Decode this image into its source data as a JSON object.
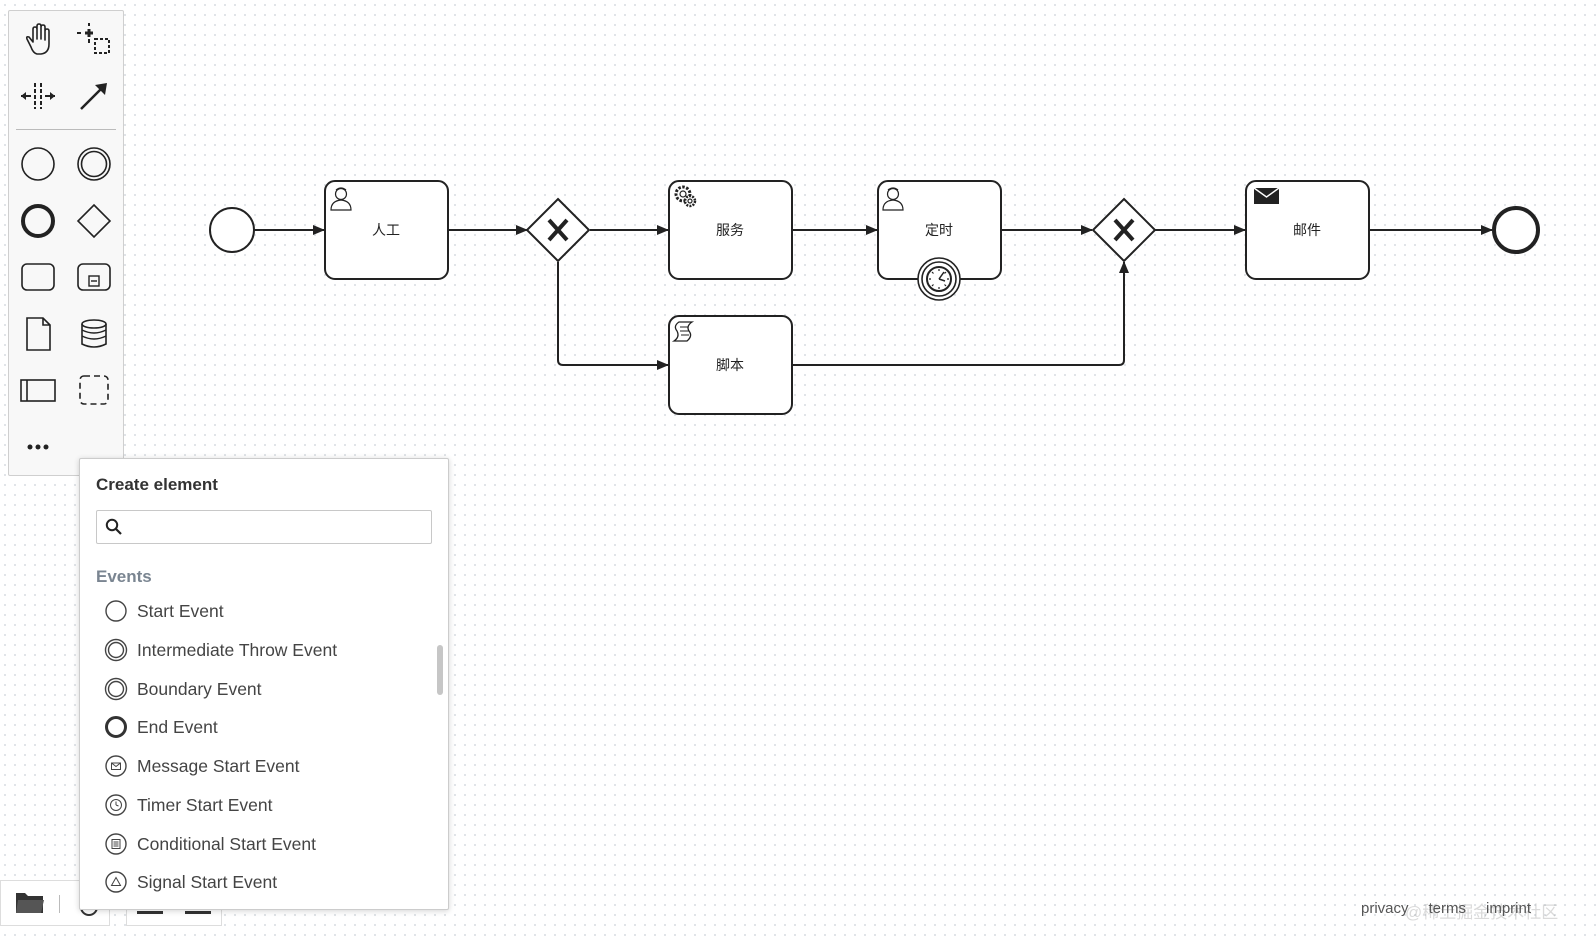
{
  "diagram": {
    "tasks": [
      {
        "label": "人工",
        "type": "user-task"
      },
      {
        "label": "服务",
        "type": "service-task"
      },
      {
        "label": "定时",
        "type": "user-task"
      },
      {
        "label": "邮件",
        "type": "send-task"
      },
      {
        "label": "脚本",
        "type": "script-task"
      }
    ]
  },
  "palette": {
    "tools": [
      "hand-tool",
      "lasso-tool",
      "space-tool",
      "global-connect-tool"
    ],
    "shapes": [
      "start-event",
      "intermediate-event",
      "end-event",
      "gateway",
      "task",
      "subprocess",
      "data-object",
      "data-store",
      "pool",
      "group",
      "more"
    ]
  },
  "popup": {
    "title": "Create element",
    "search_placeholder": "",
    "group": "Events",
    "entries": [
      {
        "label": "Start Event",
        "icon": "start-event-icon"
      },
      {
        "label": "Intermediate Throw Event",
        "icon": "intermediate-event-icon"
      },
      {
        "label": "Boundary Event",
        "icon": "boundary-event-icon"
      },
      {
        "label": "End Event",
        "icon": "end-event-icon"
      },
      {
        "label": "Message Start Event",
        "icon": "message-start-event-icon"
      },
      {
        "label": "Timer Start Event",
        "icon": "timer-start-event-icon"
      },
      {
        "label": "Conditional Start Event",
        "icon": "conditional-start-event-icon"
      },
      {
        "label": "Signal Start Event",
        "icon": "signal-start-event-icon"
      }
    ]
  },
  "footer": {
    "privacy": "privacy",
    "terms": "terms",
    "imprint": "imprint",
    "watermark": "@稀土掘金技术社区"
  }
}
